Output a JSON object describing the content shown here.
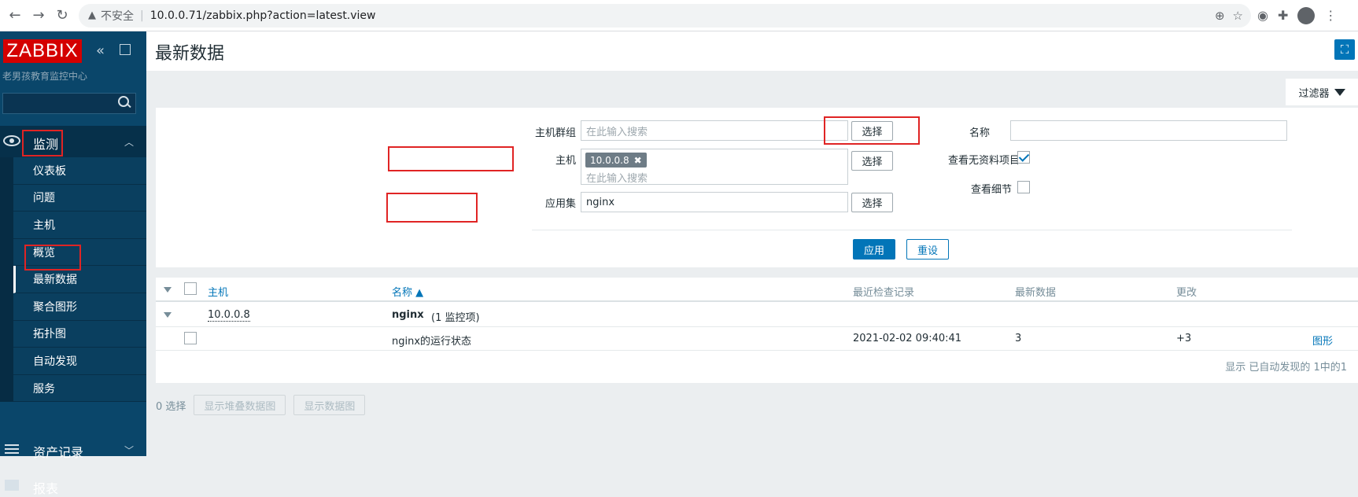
{
  "browser": {
    "security_label": "不安全",
    "url": "10.0.0.71/zabbix.php?action=latest.view"
  },
  "sidebar": {
    "logo": "ZABBIX",
    "subtitle": "老男孩教育监控中心",
    "monitoring": "监测",
    "items": [
      {
        "label": "仪表板"
      },
      {
        "label": "问题"
      },
      {
        "label": "主机"
      },
      {
        "label": "概览"
      },
      {
        "label": "最新数据"
      },
      {
        "label": "聚合图形"
      },
      {
        "label": "拓扑图"
      },
      {
        "label": "自动发现"
      },
      {
        "label": "服务"
      }
    ],
    "assets": "资产记录",
    "reports": "报表"
  },
  "header": {
    "title": "最新数据"
  },
  "filter": {
    "tab_label": "过滤器",
    "host_group_label": "主机群组",
    "host_group_placeholder": "在此输入搜索",
    "host_label": "主机",
    "host_tag": "10.0.0.8",
    "host_placeholder": "在此输入搜索",
    "app_label": "应用集",
    "app_value": "nginx",
    "select_label": "选择",
    "name_label": "名称",
    "name_value": "",
    "show_without_data_label": "查看无资料项目",
    "show_without_data": true,
    "show_details_label": "查看细节",
    "show_details": false,
    "apply_label": "应用",
    "reset_label": "重设"
  },
  "table": {
    "headers": {
      "host": "主机",
      "name": "名称 ▲",
      "last_check": "最近检查记录",
      "last_value": "最新数据",
      "change": "更改"
    },
    "group": {
      "host": "10.0.0.8",
      "app": "nginx",
      "count": "(1 监控项)"
    },
    "rows": [
      {
        "name": "nginx的运行状态",
        "last_check": "2021-02-02 09:40:41",
        "last_value": "3",
        "change": "+3",
        "action": "图形"
      }
    ],
    "footer": "显示 已自动发现的 1中的1"
  },
  "bottom": {
    "selected": "0 选择",
    "stacked_graph": "显示堆叠数据图",
    "graph": "显示数据图"
  }
}
